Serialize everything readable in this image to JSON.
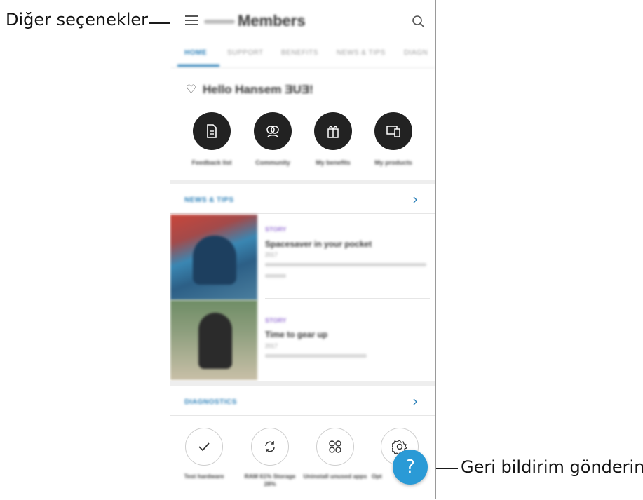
{
  "callouts": {
    "left_label": "Diğer seçenekler",
    "right_label": "Geri bildirim gönderin"
  },
  "app": {
    "title": "Members"
  },
  "tabs": [
    {
      "label": "HOME",
      "active": true
    },
    {
      "label": "SUPPORT"
    },
    {
      "label": "BENEFITS"
    },
    {
      "label": "NEWS & TIPS"
    },
    {
      "label": "DIAGN"
    }
  ],
  "greeting": {
    "text": "Hello Hansem ƎUƎ!"
  },
  "quick_actions": [
    {
      "label": "Feedback list",
      "icon": "document-icon"
    },
    {
      "label": "Community",
      "icon": "community-icon"
    },
    {
      "label": "My benefits",
      "icon": "gift-icon"
    },
    {
      "label": "My products",
      "icon": "devices-icon"
    }
  ],
  "news": {
    "header": "NEWS & TIPS",
    "items": [
      {
        "tag": "STORY",
        "title": "Spacesaver in your pocket",
        "sub": "2017"
      },
      {
        "tag": "STORY",
        "title": "Time to gear up",
        "sub": "2017"
      }
    ]
  },
  "diagnostics": {
    "header": "DIAGNOSTICS",
    "items": [
      {
        "label": "Test hardware",
        "icon": "check-icon"
      },
      {
        "label": "RAM 61% Storage 28%",
        "icon": "refresh-icon"
      },
      {
        "label": "Uninstall unused apps",
        "icon": "apps-grid-icon"
      },
      {
        "label": "Opt",
        "icon": "gear-icon"
      }
    ]
  },
  "fab": {
    "label": "?"
  },
  "colors": {
    "accent": "#2a7fb8",
    "fab": "#2a9ad6",
    "tag": "#9c78d6"
  }
}
